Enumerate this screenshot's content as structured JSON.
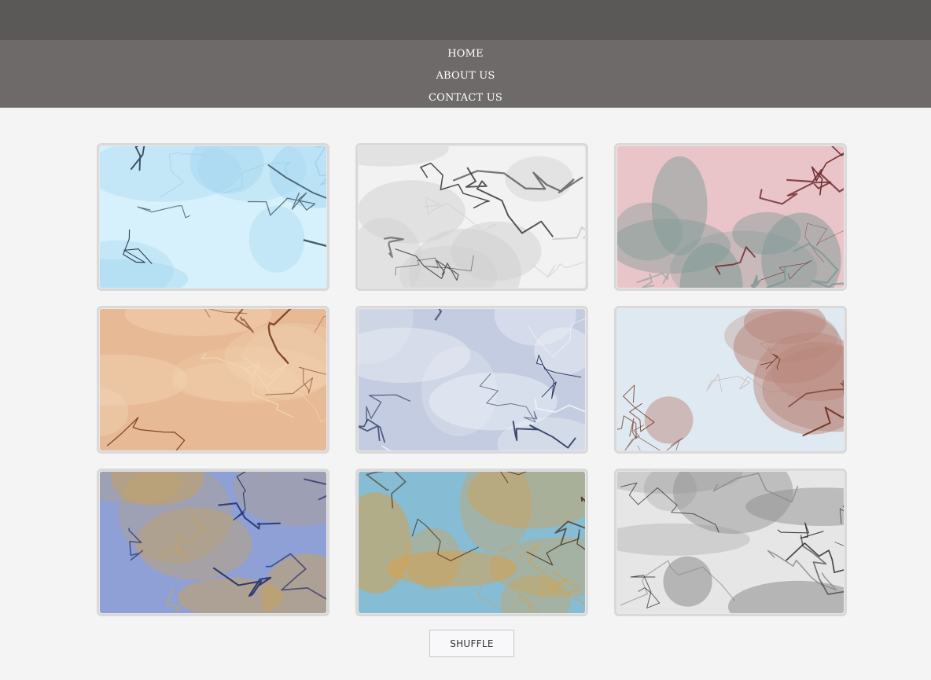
{
  "nav": {
    "home_label": "HOME",
    "about_label": "ABOUT US",
    "contact_label": "CONTACT US"
  },
  "gallery": {
    "tiles": [
      {
        "name": "marble-tile-blue-black",
        "base": "#d6f1fb",
        "vein": "#1a2a3a",
        "accent": "#9ed3ee"
      },
      {
        "name": "marble-tile-white-grey",
        "base": "#f2f2f2",
        "vein": "#3c3c3c",
        "accent": "#cfcfcf"
      },
      {
        "name": "marble-tile-pink-teal",
        "base": "#e9c5c9",
        "vein": "#6e2a2e",
        "accent": "#7f9a96"
      },
      {
        "name": "marble-tile-tan-brown",
        "base": "#e7b994",
        "vein": "#7a3a1c",
        "accent": "#f2d3b3"
      },
      {
        "name": "marble-tile-navy-white",
        "base": "#c3cce0",
        "vein": "#1d2a55",
        "accent": "#eef1f7"
      },
      {
        "name": "marble-tile-white-rust",
        "base": "#dfe9f1",
        "vein": "#6b2a1a",
        "accent": "#b9867a"
      },
      {
        "name": "marble-tile-cobalt-gold",
        "base": "#8ea0d6",
        "vein": "#1f2a66",
        "accent": "#c9a35a"
      },
      {
        "name": "marble-tile-aqua-amber",
        "base": "#86bcd4",
        "vein": "#4a2a14",
        "accent": "#d9a04a"
      },
      {
        "name": "marble-tile-black-swirl",
        "base": "#e6e6e6",
        "vein": "#1e1e1e",
        "accent": "#8a8a8a"
      }
    ]
  },
  "actions": {
    "shuffle_label": "SHUFFLE"
  }
}
